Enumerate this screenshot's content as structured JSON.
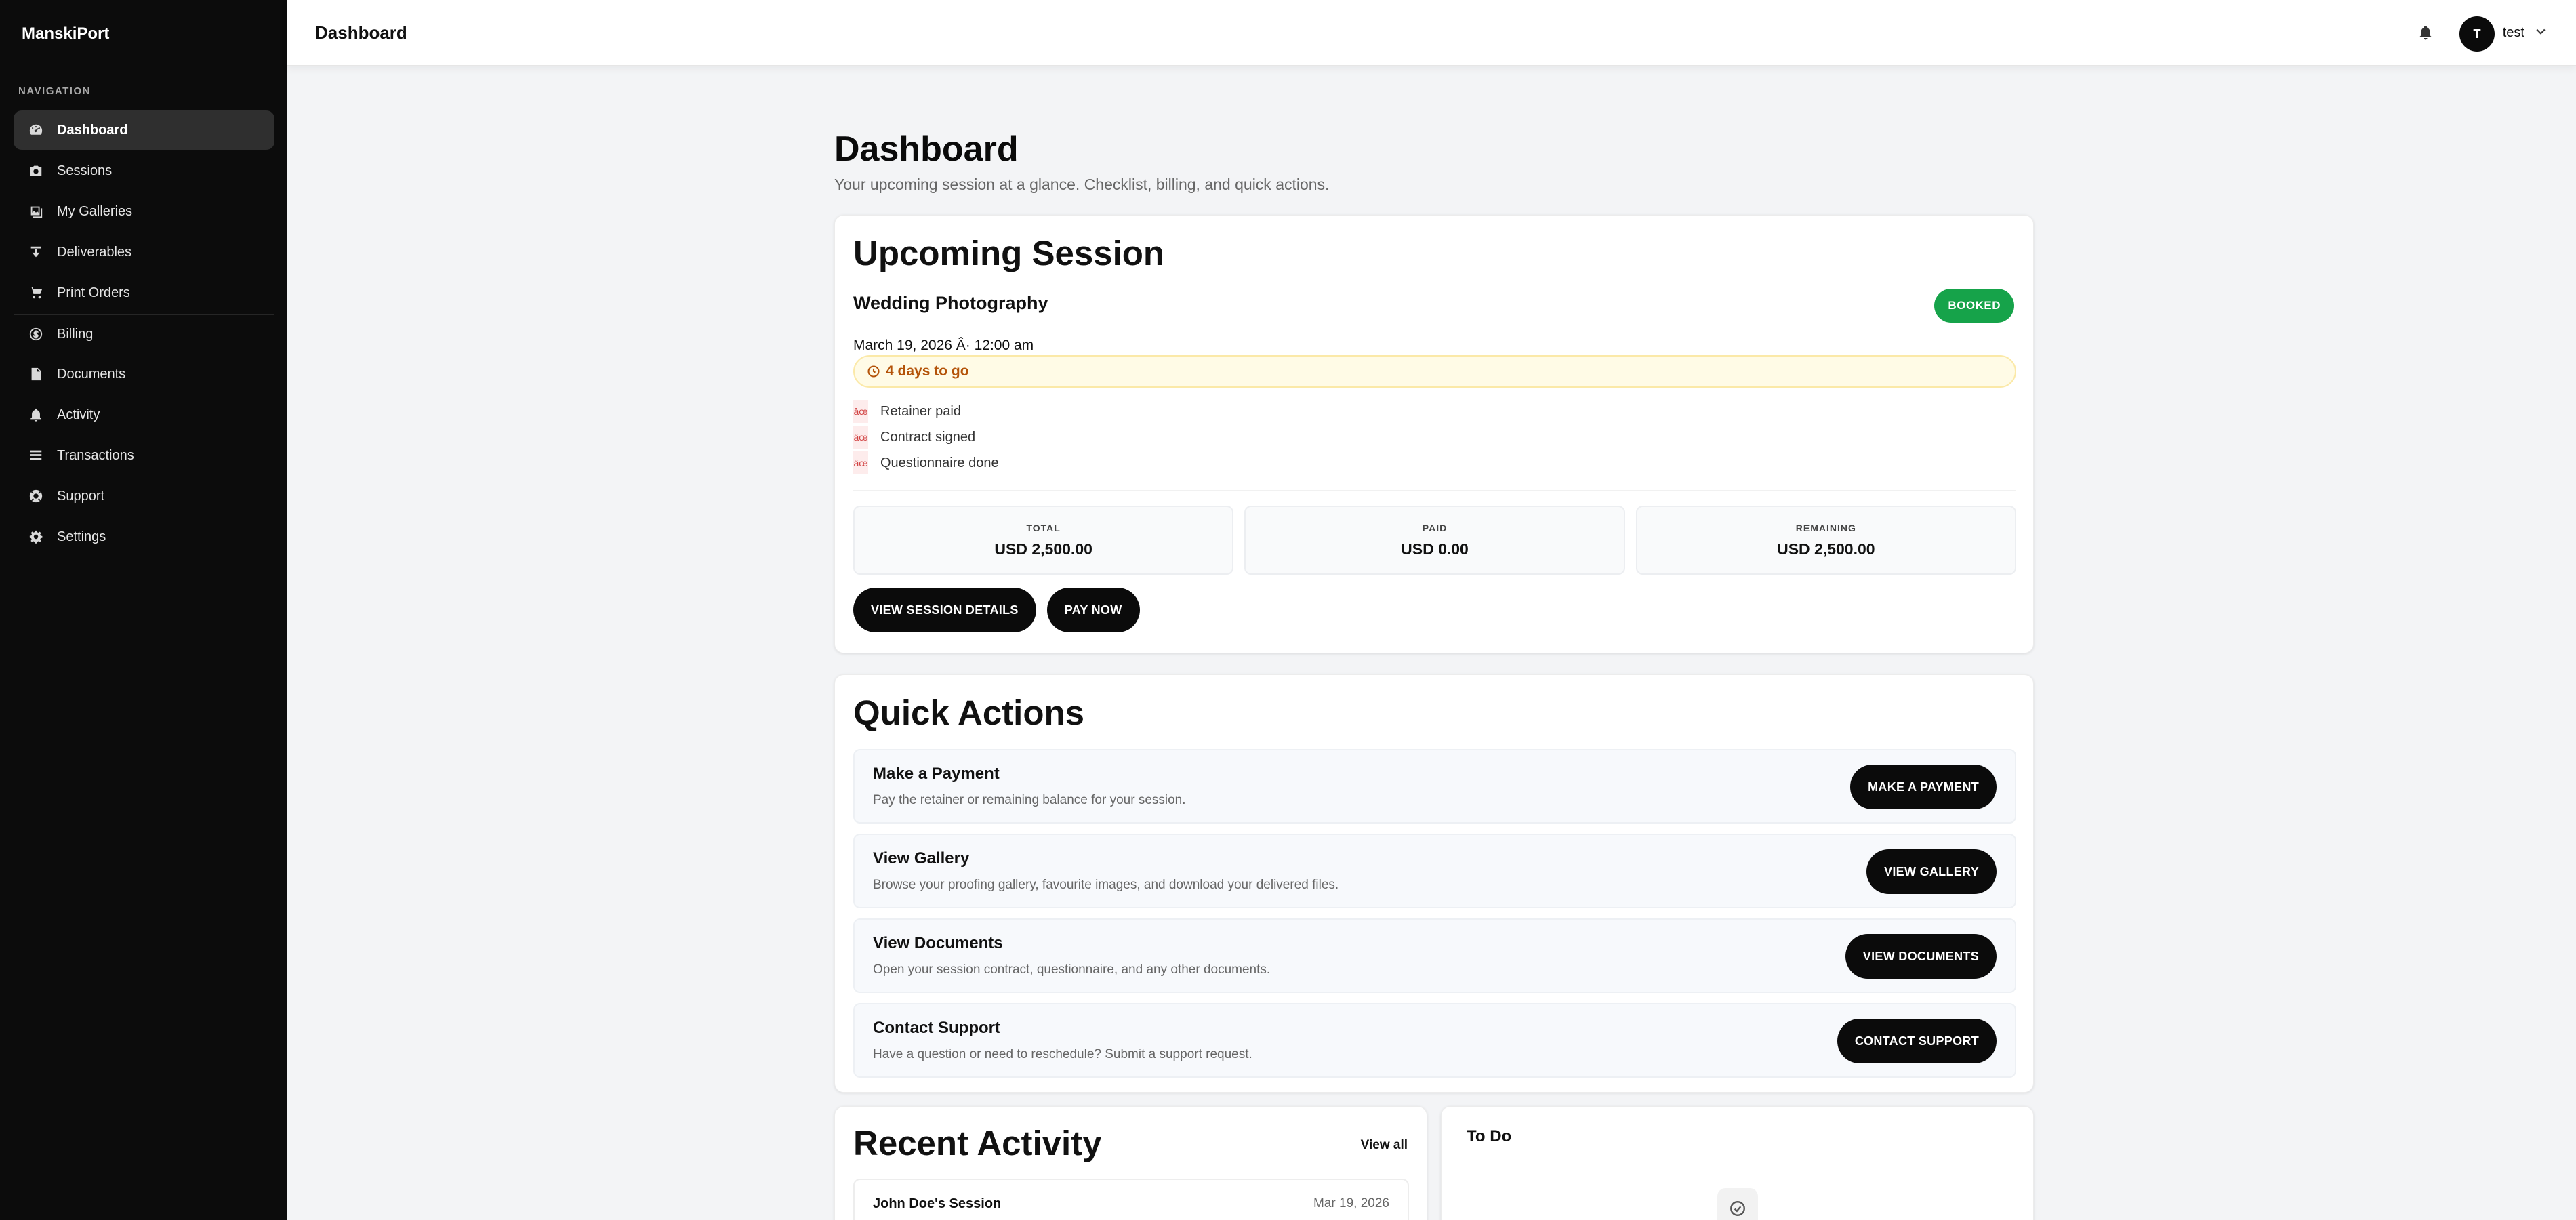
{
  "app": {
    "brand": "ManskiPort"
  },
  "sidebar": {
    "section_label": "NAVIGATION",
    "items": [
      {
        "label": "Dashboard",
        "icon": "dashboard-icon",
        "active": true
      },
      {
        "label": "Sessions",
        "icon": "camera-icon"
      },
      {
        "label": "My Galleries",
        "icon": "gallery-icon"
      },
      {
        "label": "Deliverables",
        "icon": "download-icon"
      },
      {
        "label": "Print Orders",
        "icon": "cart-icon"
      },
      {
        "label": "Billing",
        "icon": "dollar-icon"
      },
      {
        "label": "Documents",
        "icon": "document-icon"
      },
      {
        "label": "Activity",
        "icon": "bell-icon"
      },
      {
        "label": "Transactions",
        "icon": "list-icon"
      },
      {
        "label": "Support",
        "icon": "lifebuoy-icon"
      },
      {
        "label": "Settings",
        "icon": "gear-icon"
      }
    ]
  },
  "header": {
    "title": "Dashboard",
    "user_initial": "T",
    "user_name": "test"
  },
  "page": {
    "title": "Dashboard",
    "subtitle": "Your upcoming session at a glance. Checklist, billing, and quick actions."
  },
  "session": {
    "heading": "Upcoming Session",
    "name": "Wedding Photography",
    "status": "BOOKED",
    "date": "March 19, 2026 Â· 12:00 am",
    "countdown": "4 days to go",
    "checklist": [
      {
        "glyph": "âœ",
        "label": "Retainer paid"
      },
      {
        "glyph": "âœ",
        "label": "Contract signed"
      },
      {
        "glyph": "âœ",
        "label": "Questionnaire done"
      }
    ],
    "stats": [
      {
        "label": "TOTAL",
        "value": "USD 2,500.00"
      },
      {
        "label": "PAID",
        "value": "USD 0.00"
      },
      {
        "label": "REMAINING",
        "value": "USD 2,500.00"
      }
    ],
    "buttons": {
      "details": "VIEW SESSION DETAILS",
      "pay": "PAY NOW"
    }
  },
  "quick_actions": {
    "heading": "Quick Actions",
    "items": [
      {
        "title": "Make a Payment",
        "desc": "Pay the retainer or remaining balance for your session.",
        "button": "MAKE A PAYMENT"
      },
      {
        "title": "View Gallery",
        "desc": "Browse your proofing gallery, favourite images, and download your delivered files.",
        "button": "VIEW GALLERY"
      },
      {
        "title": "View Documents",
        "desc": "Open your session contract, questionnaire, and any other documents.",
        "button": "VIEW DOCUMENTS"
      },
      {
        "title": "Contact Support",
        "desc": "Have a question or need to reschedule? Submit a support request.",
        "button": "CONTACT SUPPORT"
      }
    ]
  },
  "recent_activity": {
    "heading": "Recent Activity",
    "view_all": "View all",
    "items": [
      {
        "title": "John Doe's Session",
        "date": "Mar 19, 2026"
      }
    ]
  },
  "todo": {
    "heading": "To Do"
  },
  "colors": {
    "accent": "#0b0b0b",
    "booked": "#16a34a",
    "countdown": "#b45309",
    "sidebar": "#0c0c0c"
  }
}
